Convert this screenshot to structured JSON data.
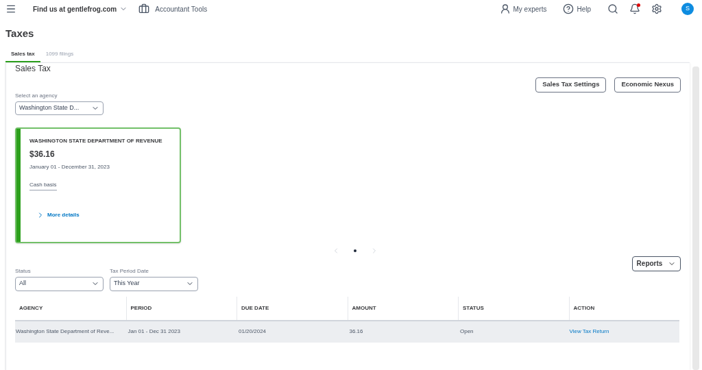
{
  "topbar": {
    "company": "Find us at gentlefrog.com",
    "tools": "Accountant Tools",
    "experts": "My experts",
    "help": "Help",
    "notification": true,
    "avatar": "S"
  },
  "page_title": "Taxes",
  "tabs": [
    {
      "label": "Sales tax",
      "selected": true
    },
    {
      "label": "1099 filings",
      "selected": false
    }
  ],
  "section_title": "Sales Tax",
  "header_buttons": [
    "Sales Tax Settings",
    "Economic Nexus"
  ],
  "agency_select": {
    "label": "Select an agency",
    "value": "Washington State D..."
  },
  "card": {
    "agency": "WASHINGTON STATE DEPARTMENT OF REVENUE",
    "amount": "$36.16",
    "period": "January 01 - December 31, 2023",
    "basis": "Cash basis",
    "link": "More details",
    "color": "#2ca01c"
  },
  "carousel": [
    {
      "selected": true
    }
  ],
  "reports_button": "Reports",
  "filters": [
    {
      "label": "Status",
      "value": "All"
    },
    {
      "label": "Tax Period Date",
      "value": "This Year"
    }
  ],
  "table": {
    "columns": [
      "AGENCY",
      "PERIOD",
      "DUE DATE",
      "AMOUNT",
      "STATUS",
      "ACTION"
    ],
    "rows": [
      {
        "cells": [
          "Washington State Department of Reve...",
          "Jan 01 - Dec 31 2023",
          "01/20/2024",
          "36.16",
          "Open"
        ],
        "action": "View Tax Return"
      }
    ]
  }
}
